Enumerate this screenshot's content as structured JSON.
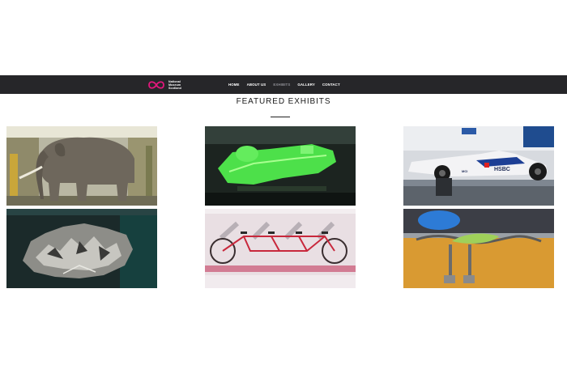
{
  "logo": {
    "line1": "National",
    "line2": "Museum",
    "line3": "Scotland",
    "accent_color": "#e3177c"
  },
  "nav": {
    "items": [
      "HOME",
      "ABOUT US",
      "EXHIBITS",
      "GALLERY",
      "CONTACT"
    ],
    "active": "EXHIBITS"
  },
  "section": {
    "title": "FEATURED EXHIBITS"
  },
  "exhibits": [
    {
      "subject": "elephant"
    },
    {
      "subject": "green-model"
    },
    {
      "subject": "race-car",
      "text": [
        "HSBC",
        "MCI"
      ]
    },
    {
      "subject": "crystals"
    },
    {
      "subject": "tandem-bicycle"
    },
    {
      "subject": "lizard-sculpture"
    }
  ]
}
